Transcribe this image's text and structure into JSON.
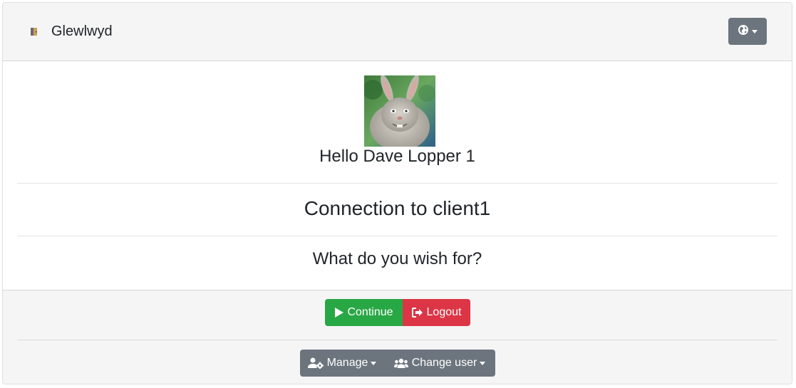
{
  "header": {
    "brand_name": "Glewlwyd",
    "brand_icon": "door-icon",
    "language_button_icon": "globe-icon"
  },
  "body": {
    "avatar_icon": "user-avatar",
    "greeting": "Hello Dave Lopper 1",
    "connection_title": "Connection to client1",
    "prompt": "What do you wish for?"
  },
  "footer": {
    "continue_label": "Continue",
    "logout_label": "Logout",
    "manage_label": "Manage",
    "change_user_label": "Change user"
  },
  "colors": {
    "success": "#28a745",
    "danger": "#dc3545",
    "secondary": "#6c757d",
    "header_bg": "#f5f5f5"
  }
}
